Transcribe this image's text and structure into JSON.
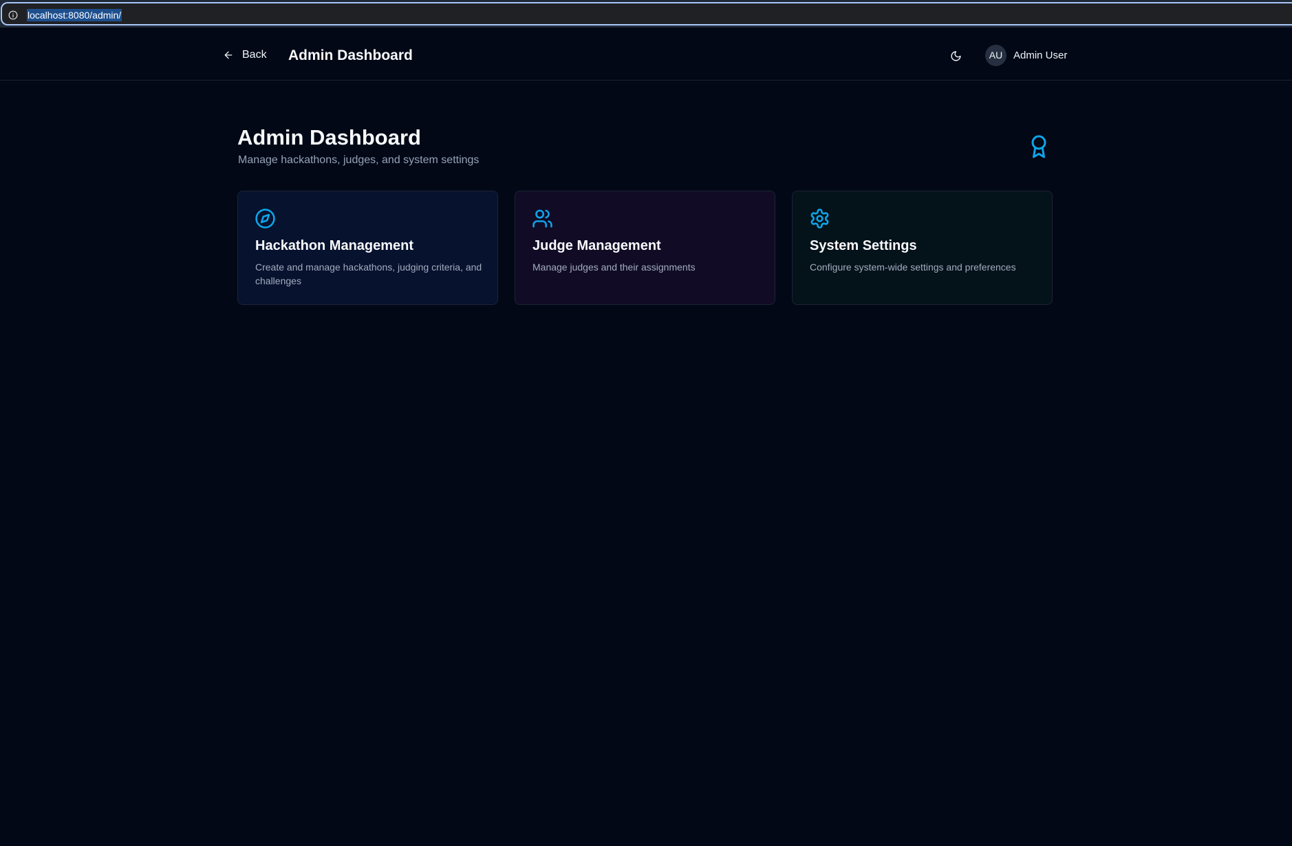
{
  "browser": {
    "url": "localhost:8080/admin/",
    "info_icon": "info-icon"
  },
  "header": {
    "back_label": "Back",
    "back_icon": "arrow-left-icon",
    "title": "Admin Dashboard",
    "theme_icon": "moon-icon",
    "user": {
      "initials": "AU",
      "name": "Admin User"
    }
  },
  "main": {
    "title": "Admin Dashboard",
    "subtitle": "Manage hackathons, judges, and system settings",
    "badge_icon": "award-icon",
    "cards": [
      {
        "icon": "compass-icon",
        "title": "Hackathon Management",
        "description": "Create and manage hackathons, judging criteria, and challenges"
      },
      {
        "icon": "users-icon",
        "title": "Judge Management",
        "description": "Manage judges and their assignments"
      },
      {
        "icon": "settings-icon",
        "title": "System Settings",
        "description": "Configure system-wide settings and preferences"
      }
    ]
  },
  "colors": {
    "background": "#030816",
    "accent": "#0ea5e9",
    "card_hackathon": "#06122e",
    "card_judge": "#110b26",
    "card_settings": "#04121a",
    "muted_text": "#94a3b8"
  }
}
